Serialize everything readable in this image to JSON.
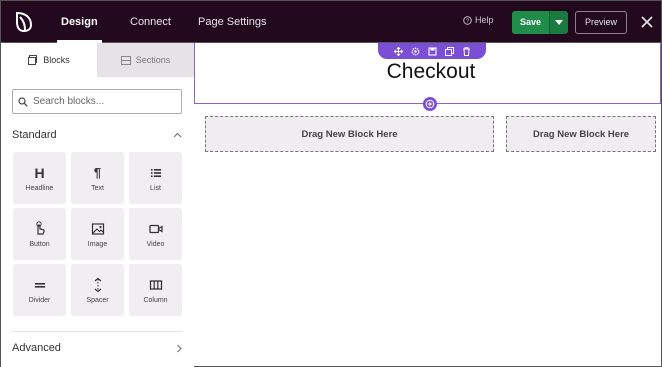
{
  "header": {
    "tabs": [
      {
        "label": "Design",
        "active": true
      },
      {
        "label": "Connect",
        "active": false
      },
      {
        "label": "Page Settings",
        "active": false
      }
    ],
    "help_label": "Help",
    "save_label": "Save",
    "preview_label": "Preview",
    "colors": {
      "bar": "#23091e",
      "save": "#1f8c4a",
      "accent": "#7b4ed6"
    }
  },
  "sidebar": {
    "tabs": [
      {
        "label": "Blocks",
        "icon": "blocks-icon",
        "active": true
      },
      {
        "label": "Sections",
        "icon": "sections-icon",
        "active": false
      }
    ],
    "search_placeholder": "Search blocks...",
    "standard_label": "Standard",
    "advanced_label": "Advanced",
    "blocks": [
      {
        "label": "Headline",
        "icon": "headline-icon"
      },
      {
        "label": "Text",
        "icon": "paragraph-icon"
      },
      {
        "label": "List",
        "icon": "list-icon"
      },
      {
        "label": "Button",
        "icon": "button-click-icon"
      },
      {
        "label": "Image",
        "icon": "image-icon"
      },
      {
        "label": "Video",
        "icon": "video-icon"
      },
      {
        "label": "Divider",
        "icon": "divider-icon"
      },
      {
        "label": "Spacer",
        "icon": "spacer-icon"
      },
      {
        "label": "Column",
        "icon": "column-icon"
      }
    ]
  },
  "canvas": {
    "heading": "Checkout",
    "section_toolbar_icons": [
      "move-icon",
      "settings-icon",
      "save-icon",
      "duplicate-icon",
      "trash-icon"
    ],
    "drop_zones": [
      "Drag New Block Here",
      "Drag New Block Here"
    ]
  }
}
